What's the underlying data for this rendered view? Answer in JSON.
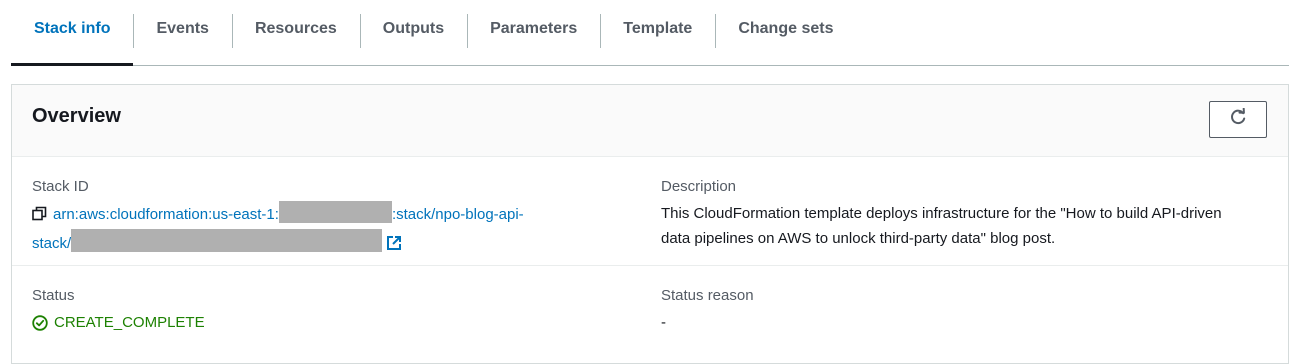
{
  "tabs": [
    {
      "label": "Stack info",
      "active": true
    },
    {
      "label": "Events",
      "active": false
    },
    {
      "label": "Resources",
      "active": false
    },
    {
      "label": "Outputs",
      "active": false
    },
    {
      "label": "Parameters",
      "active": false
    },
    {
      "label": "Template",
      "active": false
    },
    {
      "label": "Change sets",
      "active": false
    }
  ],
  "overview": {
    "title": "Overview",
    "refresh_icon": "refresh-icon",
    "stack_id": {
      "label": "Stack ID",
      "part1": "arn:aws:cloudformation:us-east-1:",
      "part2": ":stack/npo-blog-api-",
      "part3": "stack/"
    },
    "description": {
      "label": "Description",
      "value": "This CloudFormation template deploys infrastructure for the \"How to build API-driven data pipelines on AWS to unlock third-party data\" blog post."
    },
    "status": {
      "label": "Status",
      "value": "CREATE_COMPLETE",
      "color": "#1d8102"
    },
    "status_reason": {
      "label": "Status reason",
      "value": "-"
    }
  },
  "colors": {
    "link": "#0073bb",
    "success": "#1d8102",
    "redaction": "#b0b0b0"
  }
}
